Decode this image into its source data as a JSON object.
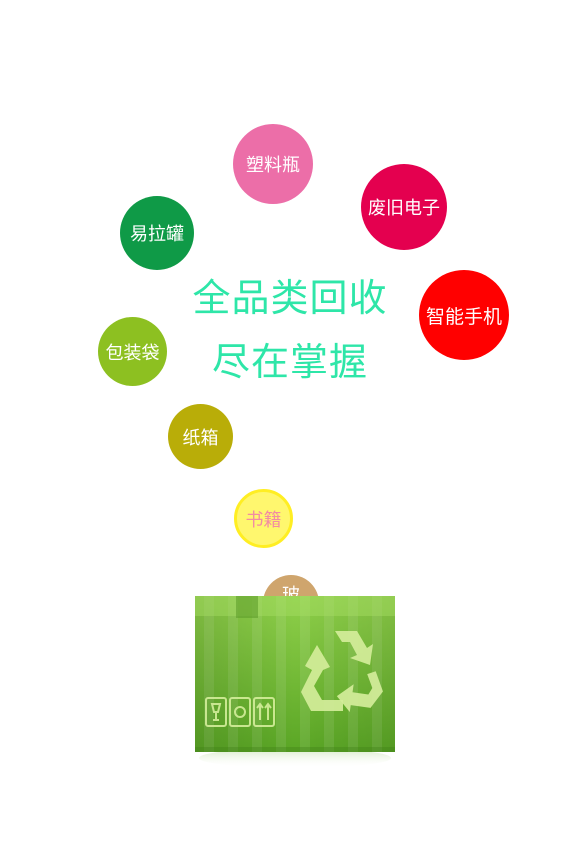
{
  "bubbles": {
    "plastic": "塑料瓶",
    "ewaste": "废旧电子",
    "can": "易拉罐",
    "phone": "智能手机",
    "bag": "包装袋",
    "carton": "纸箱",
    "book": "书籍",
    "glass": "玻"
  },
  "headline": {
    "line1": "全品类回收",
    "line2": "尽在掌握"
  },
  "colors": {
    "headline": "#2ee6a8",
    "box": "#7cc23a",
    "plastic": "#ec6ea8",
    "ewaste": "#e4004f",
    "can": "#0f9a47",
    "phone": "#ff0000",
    "bag": "#8dc021",
    "carton": "#b9ad08",
    "book": "#fff76e"
  },
  "icons": [
    "recycle-icon",
    "fragile-glass-icon",
    "this-way-up-icon"
  ]
}
